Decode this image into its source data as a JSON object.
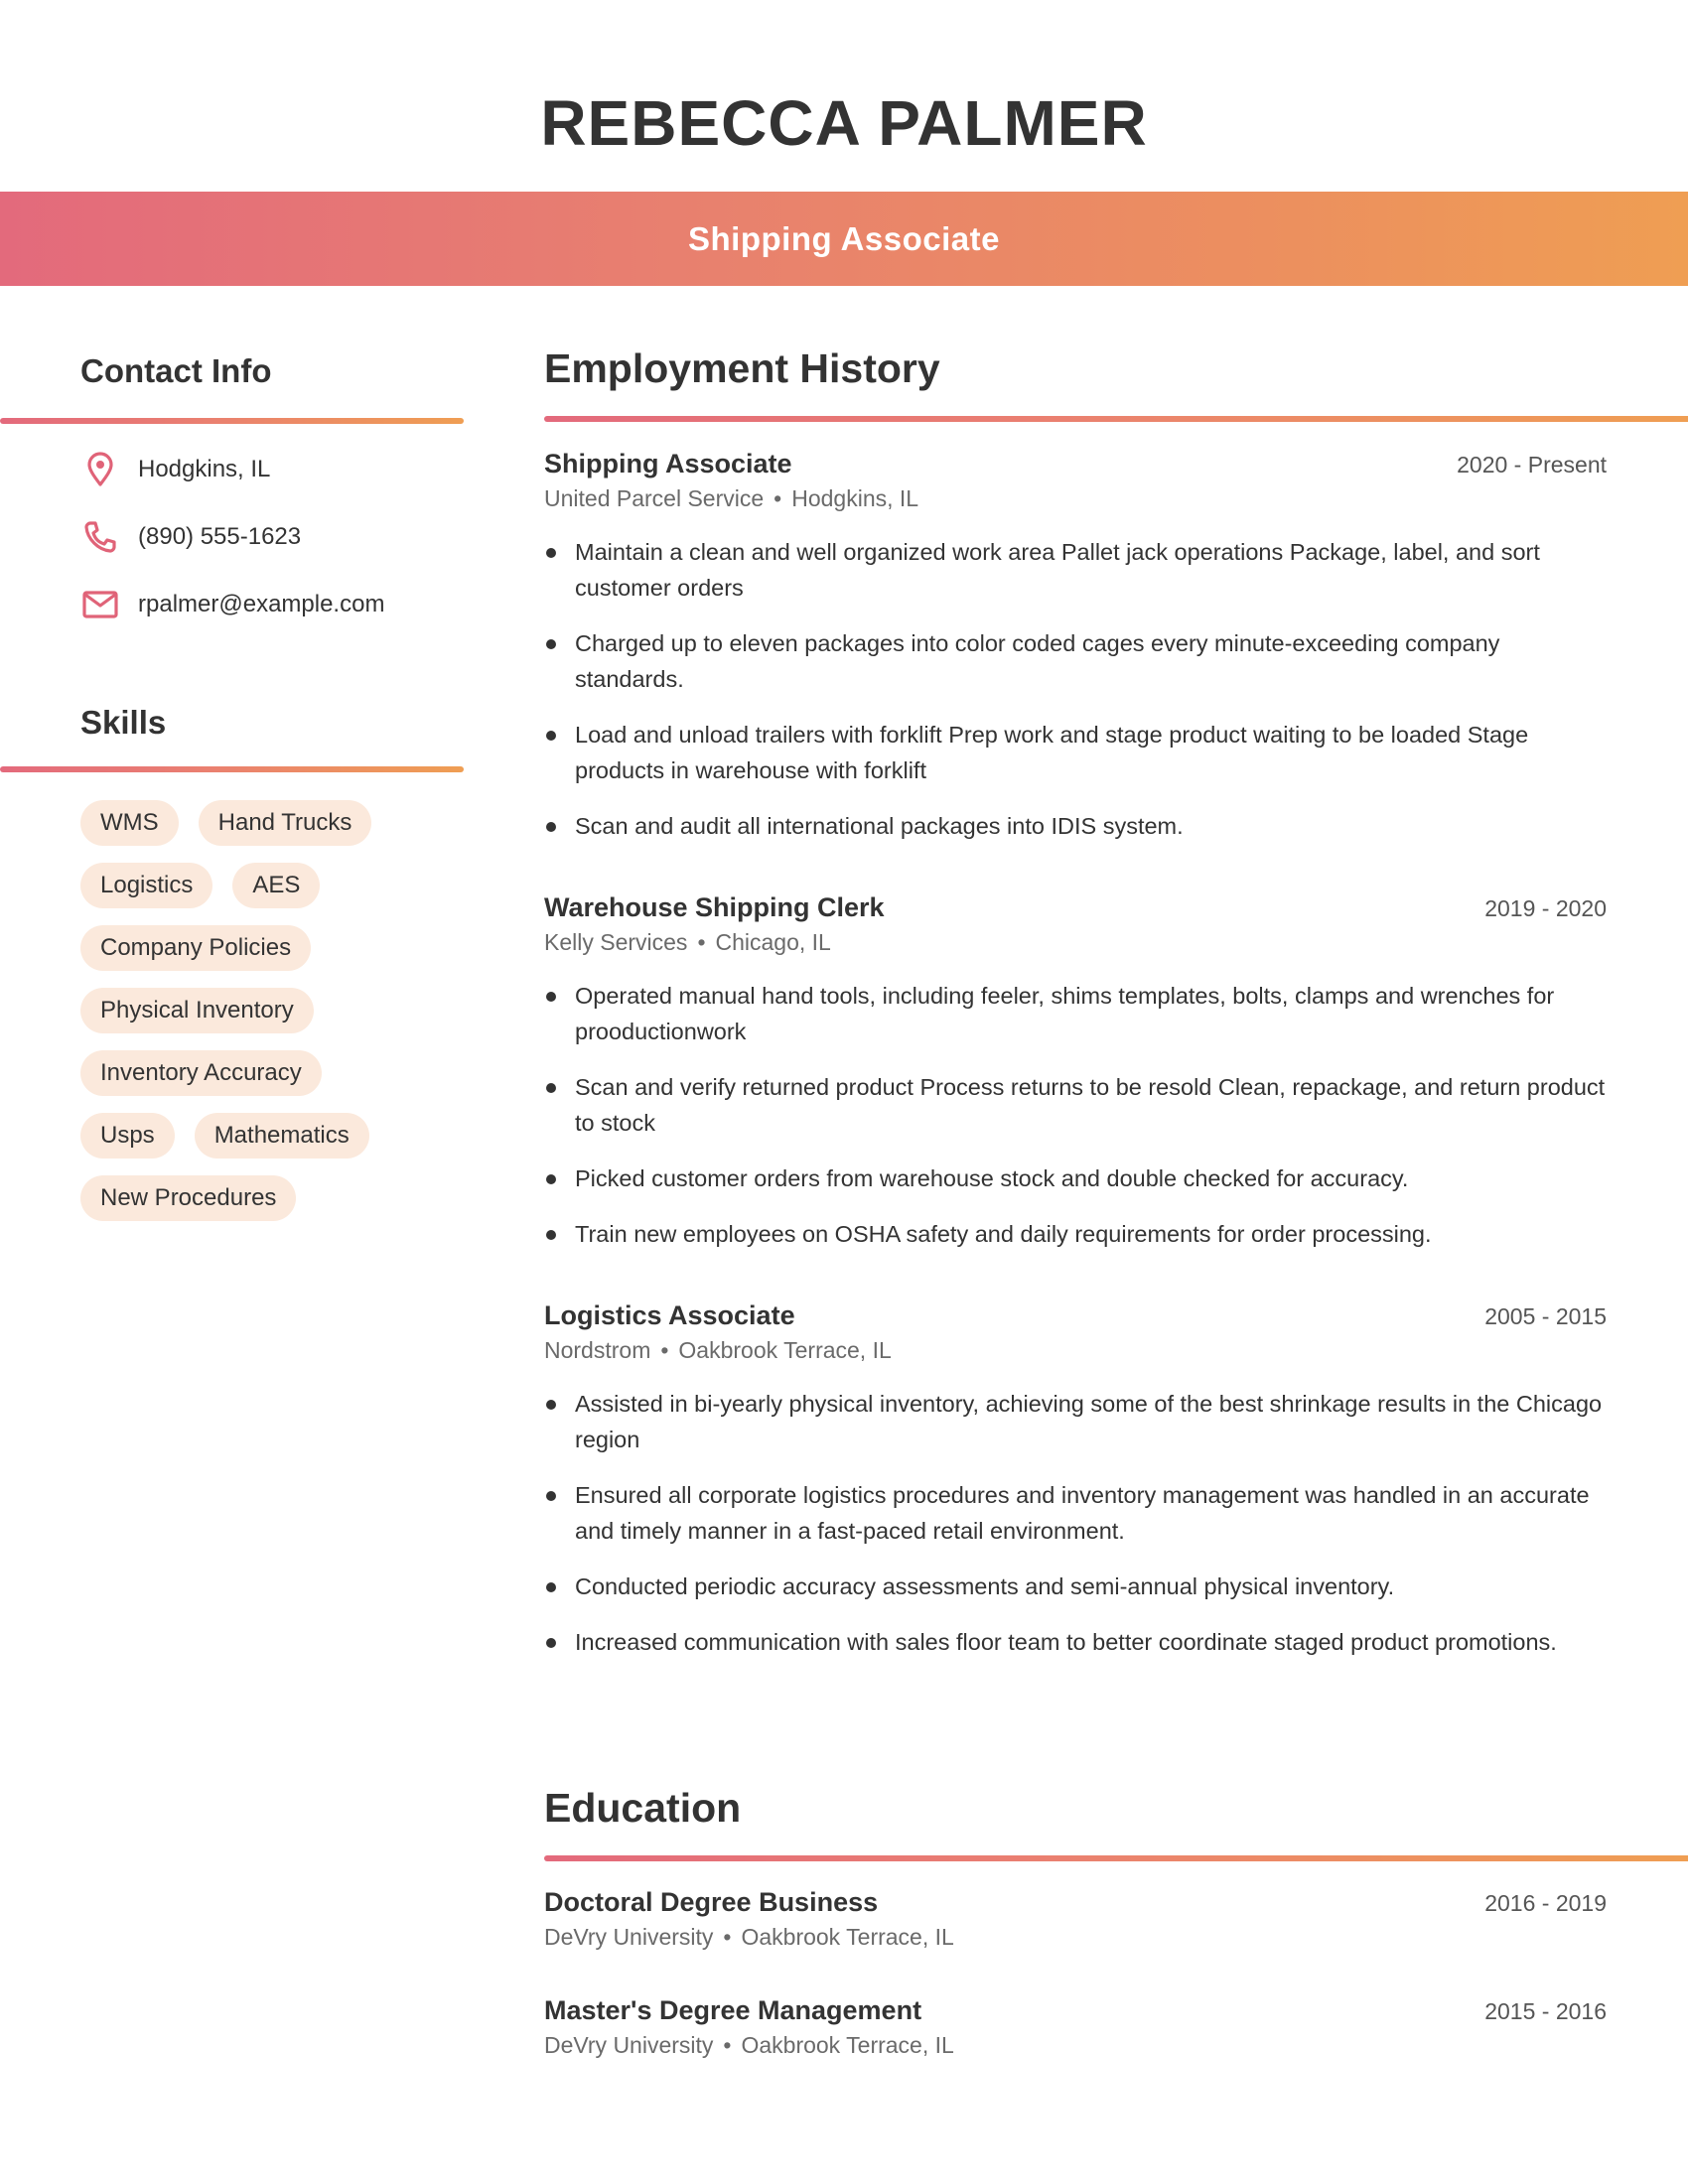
{
  "header": {
    "name": "REBECCA PALMER",
    "title": "Shipping Associate"
  },
  "theme": {
    "gradient_start": "#e36a7c",
    "gradient_end": "#ef9e53",
    "icon_color": "#e06378",
    "pill_bg": "#fbe9dc",
    "text_color": "#333333"
  },
  "contact": {
    "heading": "Contact Info",
    "items": [
      {
        "icon": "map-pin-icon",
        "text": "Hodgkins, IL"
      },
      {
        "icon": "phone-icon",
        "text": "(890) 555-1623"
      },
      {
        "icon": "mail-icon",
        "text": "rpalmer@example.com"
      }
    ]
  },
  "skills": {
    "heading": "Skills",
    "items": [
      "WMS",
      "Hand Trucks",
      "Logistics",
      "AES",
      "Company Policies",
      "Physical Inventory",
      "Inventory Accuracy",
      "Usps",
      "Mathematics",
      "New Procedures"
    ]
  },
  "employment": {
    "heading": "Employment History",
    "jobs": [
      {
        "title": "Shipping Associate",
        "dates": "2020 - Present",
        "company": "United Parcel Service",
        "location": "Hodgkins, IL",
        "bullets": [
          "Maintain a clean and well organized work area Pallet jack operations Package, label, and sort customer orders",
          "Charged up to eleven packages into color coded cages every minute-exceeding company standards.",
          "Load and unload trailers with forklift Prep work and stage product waiting to be loaded Stage products in warehouse with forklift",
          "Scan and audit all international packages into IDIS system."
        ]
      },
      {
        "title": "Warehouse Shipping Clerk",
        "dates": "2019 - 2020",
        "company": "Kelly Services",
        "location": "Chicago, IL",
        "bullets": [
          "Operated manual hand tools, including feeler, shims templates, bolts, clamps and wrenches for prooductionwork",
          "Scan and verify returned product Process returns to be resold Clean, repackage, and return product to stock",
          "Picked customer orders from warehouse stock and double checked for accuracy.",
          "Train new employees on OSHA safety and daily requirements for order processing."
        ]
      },
      {
        "title": "Logistics Associate",
        "dates": "2005 - 2015",
        "company": "Nordstrom",
        "location": "Oakbrook Terrace, IL",
        "bullets": [
          "Assisted in bi-yearly physical inventory, achieving some of the best shrinkage results in the Chicago region",
          "Ensured all corporate logistics procedures and inventory management was handled in an accurate and timely manner in a fast-paced retail environment.",
          "Conducted periodic accuracy assessments and semi-annual physical inventory.",
          "Increased communication with sales floor team to better coordinate staged product promotions."
        ]
      }
    ]
  },
  "education": {
    "heading": "Education",
    "entries": [
      {
        "degree": "Doctoral Degree Business",
        "dates": "2016 - 2019",
        "school": "DeVry University",
        "location": "Oakbrook Terrace, IL"
      },
      {
        "degree": "Master's Degree Management",
        "dates": "2015 - 2016",
        "school": "DeVry University",
        "location": "Oakbrook Terrace, IL"
      }
    ]
  }
}
